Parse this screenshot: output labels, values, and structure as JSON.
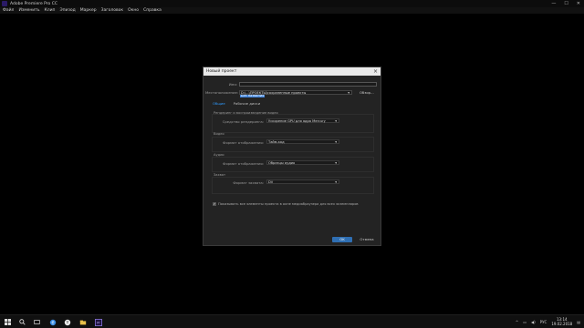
{
  "window": {
    "title": "Adobe Premiere Pro CC",
    "controls": [
      "—",
      "☐",
      "✕"
    ]
  },
  "menu": [
    "Файл",
    "Изменить",
    "Клип",
    "Эпизод",
    "Маркер",
    "Заголовок",
    "Окно",
    "Справка"
  ],
  "dialog": {
    "title": "Новый проект",
    "name_label": "Имя:",
    "name_value": "Без названия",
    "location_label": "Местоположение:",
    "location_value": "D:\\...\\ПРОЕКТЫ\\сохраненные проекты",
    "browse_label": "Обзор...",
    "tabs": [
      {
        "label": "Общие",
        "active": true
      },
      {
        "label": "Рабочие диски",
        "active": false
      }
    ],
    "render_section": "Рендеринг и воспроизведение видео",
    "renderer_label": "Средство рендеринга:",
    "renderer_value": "Ускорение GPU для ядра Mercury",
    "video_section": "Видео",
    "video_format_label": "Формат отображения:",
    "video_format_value": "Тайм-код",
    "audio_section": "Аудио",
    "audio_format_label": "Формат отображения:",
    "audio_format_value": "Образцы аудио",
    "capture_section": "Захват",
    "capture_format_label": "Формат захвата:",
    "capture_format_value": "DV",
    "checkbox_label": "Показывать все элементы проекта в окне медиабраузера для всех экземпляров",
    "ok_label": "OK",
    "cancel_label": "Отмена"
  },
  "taskbar": {
    "icons": [
      "windows-icon",
      "search-icon",
      "task-view-icon",
      "edge-icon",
      "yandex-icon",
      "explorer-icon",
      "store-icon",
      "premiere-icon"
    ],
    "tray_lang": "РУС",
    "time": "13:14",
    "date": "19.02.2018"
  }
}
